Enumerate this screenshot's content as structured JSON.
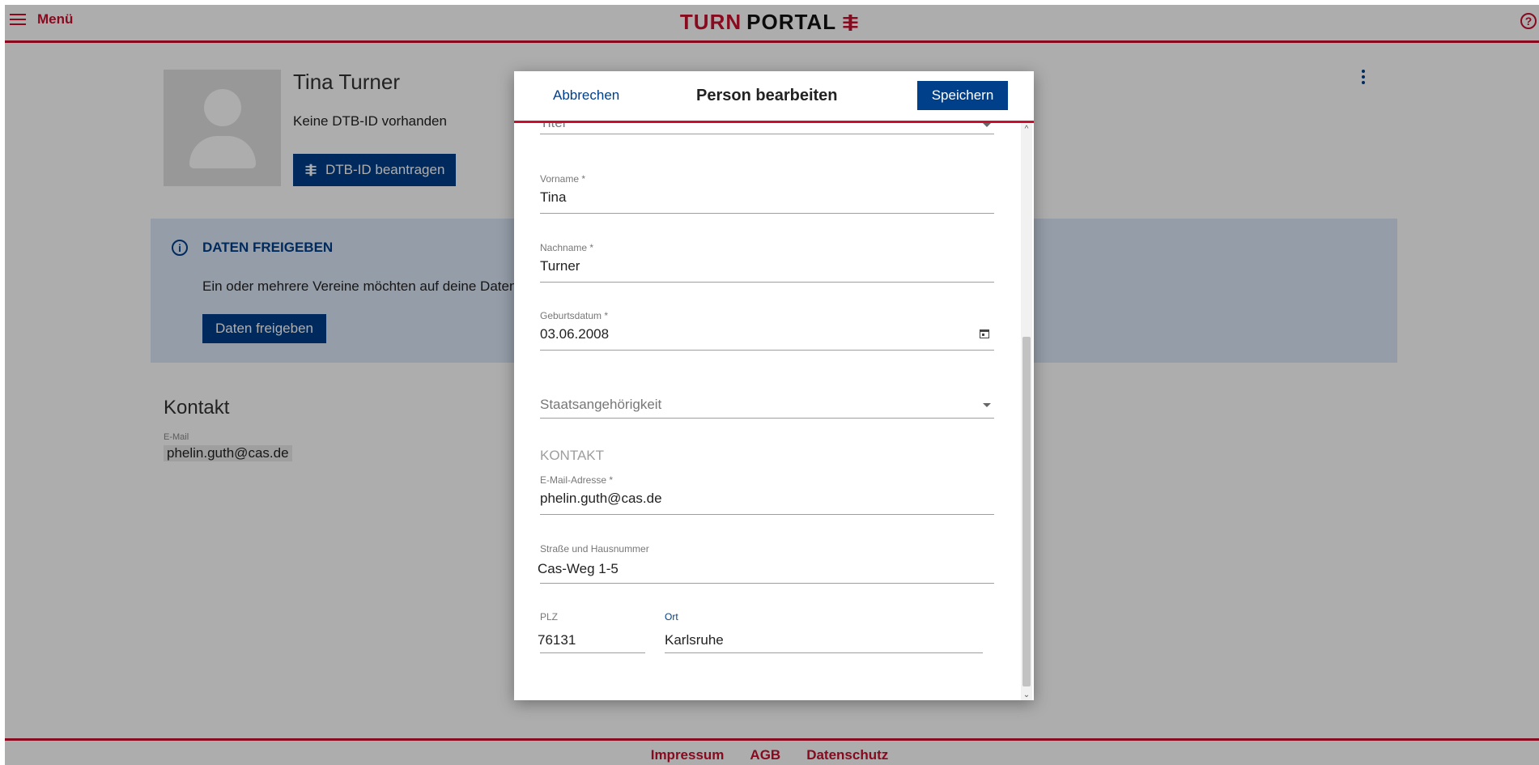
{
  "header": {
    "menu_label": "Menü",
    "logo_part1": "TURN",
    "logo_part2": "PORTAL",
    "help_symbol": "?"
  },
  "profile": {
    "name": "Tina Turner",
    "dtb_status": "Keine DTB-ID vorhanden",
    "dtb_button": "DTB-ID beantragen"
  },
  "share": {
    "title": "DATEN FREIGEBEN",
    "text": "Ein oder mehrere Vereine möchten auf deine Daten",
    "button": "Daten freigeben"
  },
  "contact": {
    "title": "Kontakt",
    "email_label": "E-Mail",
    "email_value": "phelin.guth@cas.de"
  },
  "footer": {
    "links": [
      "Impressum",
      "AGB",
      "Datenschutz"
    ]
  },
  "dialog": {
    "cancel": "Abbrechen",
    "title": "Person bearbeiten",
    "save": "Speichern",
    "fields": {
      "titel_placeholder": "Titel",
      "vorname_label": "Vorname *",
      "vorname_value": "Tina",
      "nachname_label": "Nachname *",
      "nachname_value": "Turner",
      "geburtsdatum_label": "Geburtsdatum *",
      "geburtsdatum_value": "03.06.2008",
      "staat_placeholder": "Staatsangehörigkeit",
      "section_kontakt": "KONTAKT",
      "email_label": "E-Mail-Adresse *",
      "email_value": "phelin.guth@cas.de",
      "strasse_label": "Straße und Hausnummer",
      "strasse_value": "Cas-Weg 1-5",
      "plz_label": "PLZ",
      "plz_value": "76131",
      "ort_label": "Ort",
      "ort_value": "Karlsruhe"
    }
  },
  "colors": {
    "brand_red": "#c8102e",
    "primary_blue": "#003f8a",
    "info_bg": "#dbe7f8"
  },
  "icons": [
    "menu-icon",
    "help-icon",
    "dtb-logo-icon",
    "info-icon",
    "more-vert-icon",
    "calendar-icon",
    "dropdown-caret-icon"
  ]
}
